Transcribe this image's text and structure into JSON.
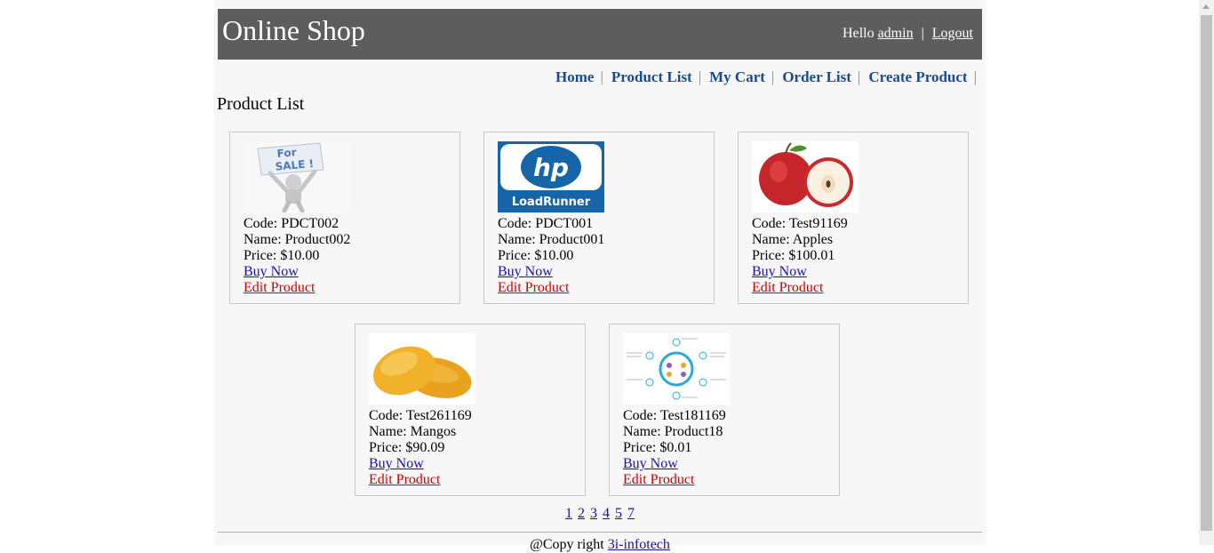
{
  "header": {
    "site_title": "Online Shop",
    "hello_text": "Hello",
    "username": "admin",
    "separator": "|",
    "logout_label": "Logout"
  },
  "menu": {
    "items": [
      {
        "label": "Home"
      },
      {
        "label": "Product List"
      },
      {
        "label": "My Cart"
      },
      {
        "label": "Order List"
      },
      {
        "label": "Create Product"
      }
    ],
    "separator": "|"
  },
  "page_heading": "Product List",
  "products": [
    {
      "code_label": "Code: PDCT002",
      "name_label": "Name: Product002",
      "price_label": "Price: $10.00",
      "buy_label": "Buy Now",
      "edit_label": "Edit Product",
      "image": "for-sale-figure"
    },
    {
      "code_label": "Code: PDCT001",
      "name_label": "Name: Product001",
      "price_label": "Price: $10.00",
      "buy_label": "Buy Now",
      "edit_label": "Edit Product",
      "image": "hp-loadrunner-logo",
      "image_text_1": "hp",
      "image_text_2": "LoadRunner"
    },
    {
      "code_label": "Code: Test91169",
      "name_label": "Name: Apples",
      "price_label": "Price: $100.01",
      "buy_label": "Buy Now",
      "edit_label": "Edit Product",
      "image": "apple-photo"
    },
    {
      "code_label": "Code: Test261169",
      "name_label": "Name: Mangos",
      "price_label": "Price: $90.09",
      "buy_label": "Buy Now",
      "edit_label": "Edit Product",
      "image": "mango-photo"
    },
    {
      "code_label": "Code: Test181169",
      "name_label": "Name: Product18",
      "price_label": "Price: $0.01",
      "buy_label": "Buy Now",
      "edit_label": "Edit Product",
      "image": "diagram-thumbnail"
    }
  ],
  "pagination": {
    "pages": [
      "1",
      "2",
      "3",
      "4",
      "5",
      "7"
    ]
  },
  "footer": {
    "prefix": "@Copy right",
    "link": "3i-infotech"
  },
  "colors": {
    "header_bg": "#5d5d5d",
    "page_bg": "#f7f7f7",
    "menu_link": "#1a4c8c",
    "buy_link": "#1a0dab",
    "edit_link": "#cc0000"
  }
}
